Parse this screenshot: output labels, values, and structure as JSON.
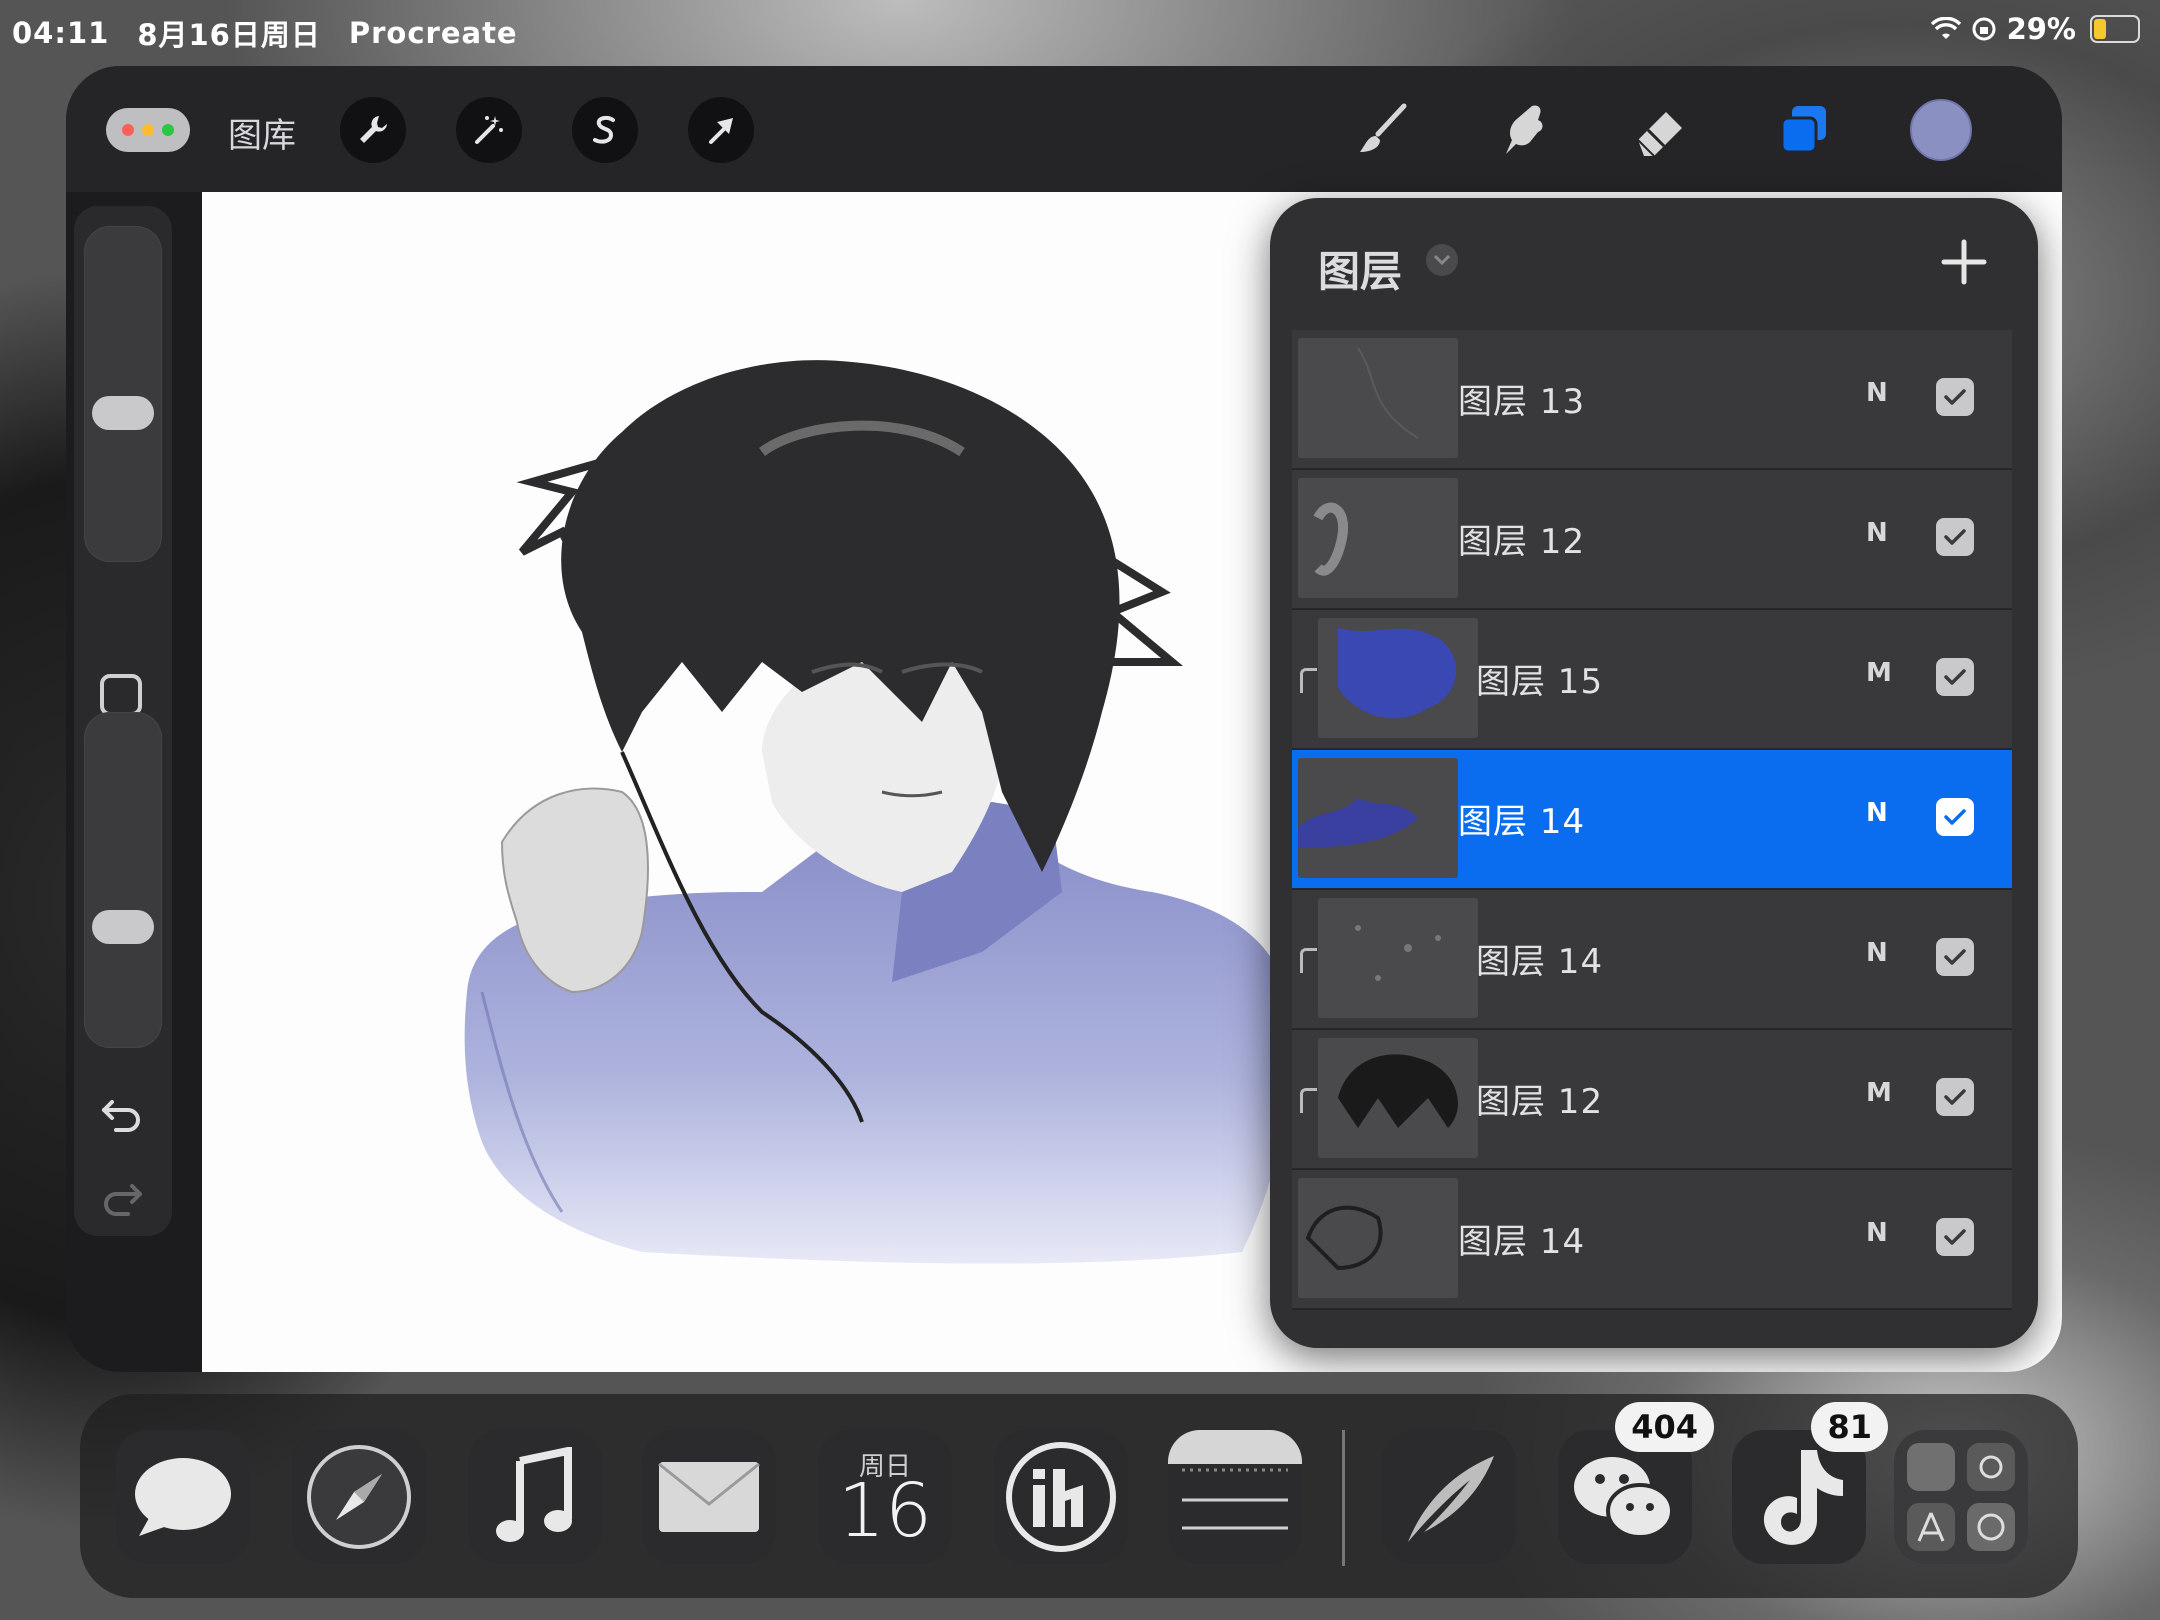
{
  "status_bar": {
    "time": "04:11",
    "date": "8月16日周日",
    "app_name": "Procreate",
    "battery": "29%",
    "battery_level": 0.29
  },
  "toolbar": {
    "gallery_label": "图库",
    "current_color": "#8b90c2"
  },
  "layers_panel": {
    "title": "图层",
    "layers": [
      {
        "name": "图层 13",
        "mode": "N",
        "visible": true,
        "clipped": false,
        "selected": false
      },
      {
        "name": "图层 12",
        "mode": "N",
        "visible": true,
        "clipped": false,
        "selected": false
      },
      {
        "name": "图层 15",
        "mode": "M",
        "visible": true,
        "clipped": true,
        "selected": false
      },
      {
        "name": "图层 14",
        "mode": "N",
        "visible": true,
        "clipped": false,
        "selected": true
      },
      {
        "name": "图层 14",
        "mode": "N",
        "visible": true,
        "clipped": true,
        "selected": false
      },
      {
        "name": "图层 12",
        "mode": "M",
        "visible": true,
        "clipped": true,
        "selected": false
      },
      {
        "name": "图层 14",
        "mode": "N",
        "visible": true,
        "clipped": false,
        "selected": false
      }
    ]
  },
  "dock": {
    "calendar_weekday": "周日",
    "calendar_day": "16",
    "wechat_badge": "404",
    "tiktok_badge": "81"
  },
  "colors": {
    "accent": "#0a6df0",
    "sweater": "#8b90c2"
  }
}
